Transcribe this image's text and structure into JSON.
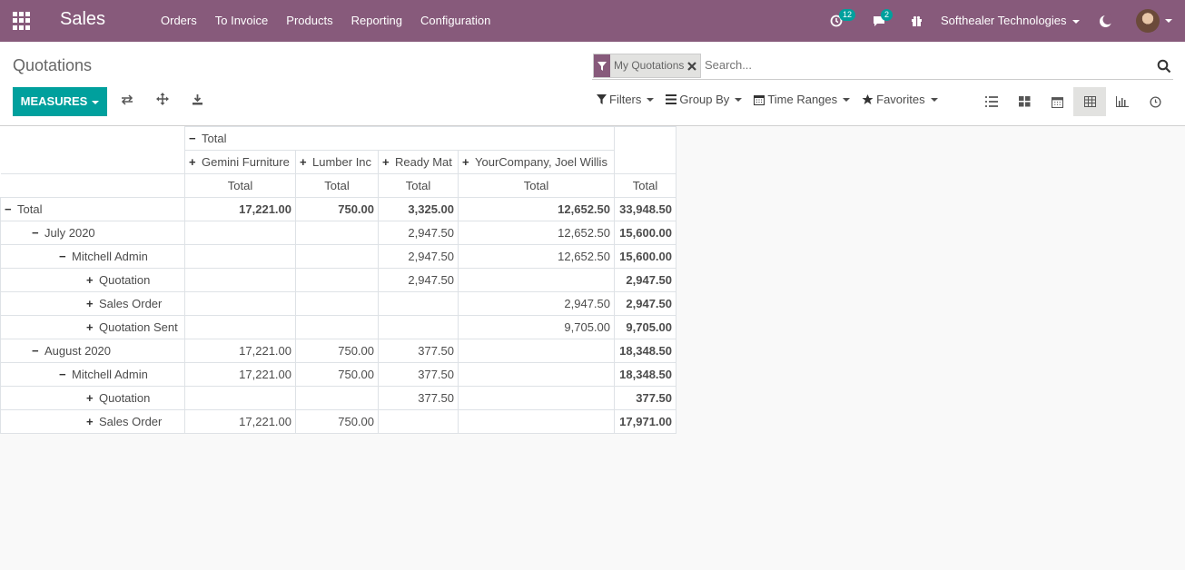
{
  "app": {
    "name": "Sales",
    "menu": [
      "Orders",
      "To Invoice",
      "Products",
      "Reporting",
      "Configuration"
    ],
    "activity_count": "12",
    "message_count": "2",
    "company": "Softhealer Technologies"
  },
  "control": {
    "title": "Quotations",
    "measures_label": "MEASURES",
    "facet_label": "My Quotations",
    "search_placeholder": "Search...",
    "filters_label": "Filters",
    "groupby_label": "Group By",
    "timeranges_label": "Time Ranges",
    "favorites_label": "Favorites"
  },
  "pivot": {
    "col_group_label": "Total",
    "columns": [
      "Gemini Furniture",
      "Lumber Inc",
      "Ready Mat",
      "YourCompany, Joel Willis"
    ],
    "measure_label": "Total",
    "rows": [
      {
        "sign": "−",
        "label": "Total",
        "values": [
          "17,221.00",
          "750.00",
          "3,325.00",
          "12,652.50"
        ],
        "total": "33,948.50"
      },
      {
        "sign": "−",
        "label": "July 2020",
        "values": [
          "",
          "",
          "2,947.50",
          "12,652.50"
        ],
        "total": "15,600.00"
      },
      {
        "sign": "−",
        "label": "Mitchell Admin",
        "values": [
          "",
          "",
          "2,947.50",
          "12,652.50"
        ],
        "total": "15,600.00"
      },
      {
        "sign": "+",
        "label": "Quotation",
        "values": [
          "",
          "",
          "2,947.50",
          ""
        ],
        "total": "2,947.50"
      },
      {
        "sign": "+",
        "label": "Sales Order",
        "values": [
          "",
          "",
          "",
          "2,947.50"
        ],
        "total": "2,947.50"
      },
      {
        "sign": "+",
        "label": "Quotation Sent",
        "values": [
          "",
          "",
          "",
          "9,705.00"
        ],
        "total": "9,705.00"
      },
      {
        "sign": "−",
        "label": "August 2020",
        "values": [
          "17,221.00",
          "750.00",
          "377.50",
          ""
        ],
        "total": "18,348.50"
      },
      {
        "sign": "−",
        "label": "Mitchell Admin",
        "values": [
          "17,221.00",
          "750.00",
          "377.50",
          ""
        ],
        "total": "18,348.50"
      },
      {
        "sign": "+",
        "label": "Quotation",
        "values": [
          "",
          "",
          "377.50",
          ""
        ],
        "total": "377.50"
      },
      {
        "sign": "+",
        "label": "Sales Order",
        "values": [
          "17,221.00",
          "750.00",
          "",
          ""
        ],
        "total": "17,971.00"
      }
    ]
  }
}
